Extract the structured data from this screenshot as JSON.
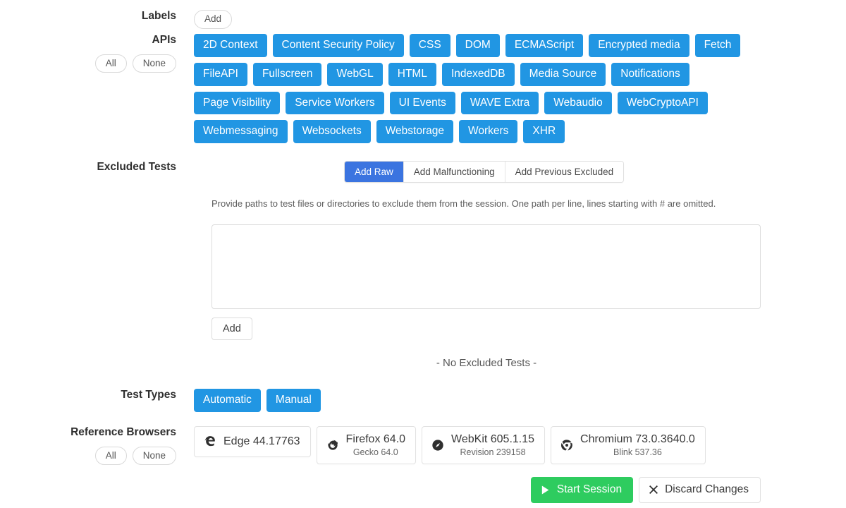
{
  "sections": {
    "labels": {
      "label": "Labels",
      "add_label": "Add"
    },
    "apis": {
      "label": "APIs",
      "all_label": "All",
      "none_label": "None",
      "tags": [
        "2D Context",
        "Content Security Policy",
        "CSS",
        "DOM",
        "ECMAScript",
        "Encrypted media",
        "Fetch",
        "FileAPI",
        "Fullscreen",
        "WebGL",
        "HTML",
        "IndexedDB",
        "Media Source",
        "Notifications",
        "Page Visibility",
        "Service Workers",
        "UI Events",
        "WAVE Extra",
        "Webaudio",
        "WebCryptoAPI",
        "Webmessaging",
        "Websockets",
        "Webstorage",
        "Workers",
        "XHR"
      ]
    },
    "excluded_tests": {
      "label": "Excluded Tests",
      "mode_buttons": [
        {
          "label": "Add Raw",
          "active": true
        },
        {
          "label": "Add Malfunctioning",
          "active": false
        },
        {
          "label": "Add Previous Excluded",
          "active": false
        }
      ],
      "help_text": "Provide paths to test files or directories to exclude them from the session. One path per line, lines starting with # are omitted.",
      "textarea_value": "",
      "textarea_placeholder": "",
      "add_label": "Add",
      "empty_message": "- No Excluded Tests -"
    },
    "test_types": {
      "label": "Test Types",
      "tags": [
        "Automatic",
        "Manual"
      ]
    },
    "reference_browsers": {
      "label": "Reference Browsers",
      "all_label": "All",
      "none_label": "None",
      "browsers": [
        {
          "icon": "edge-icon",
          "title": "Edge 44.17763",
          "subtitle": ""
        },
        {
          "icon": "firefox-icon",
          "title": "Firefox 64.0",
          "subtitle": "Gecko 64.0"
        },
        {
          "icon": "webkit-icon",
          "title": "WebKit 605.1.15",
          "subtitle": "Revision 239158"
        },
        {
          "icon": "chromium-icon",
          "title": "Chromium 73.0.3640.0",
          "subtitle": "Blink 537.36"
        }
      ]
    }
  },
  "actions": {
    "start_label": "Start Session",
    "start_icon": "play-icon",
    "discard_label": "Discard Changes",
    "discard_icon": "close-icon"
  },
  "colors": {
    "tag_blue": "#2196e3",
    "segment_active_blue": "#3b74e0",
    "start_green": "#2ecc5f",
    "text": "#3a3a3a"
  }
}
